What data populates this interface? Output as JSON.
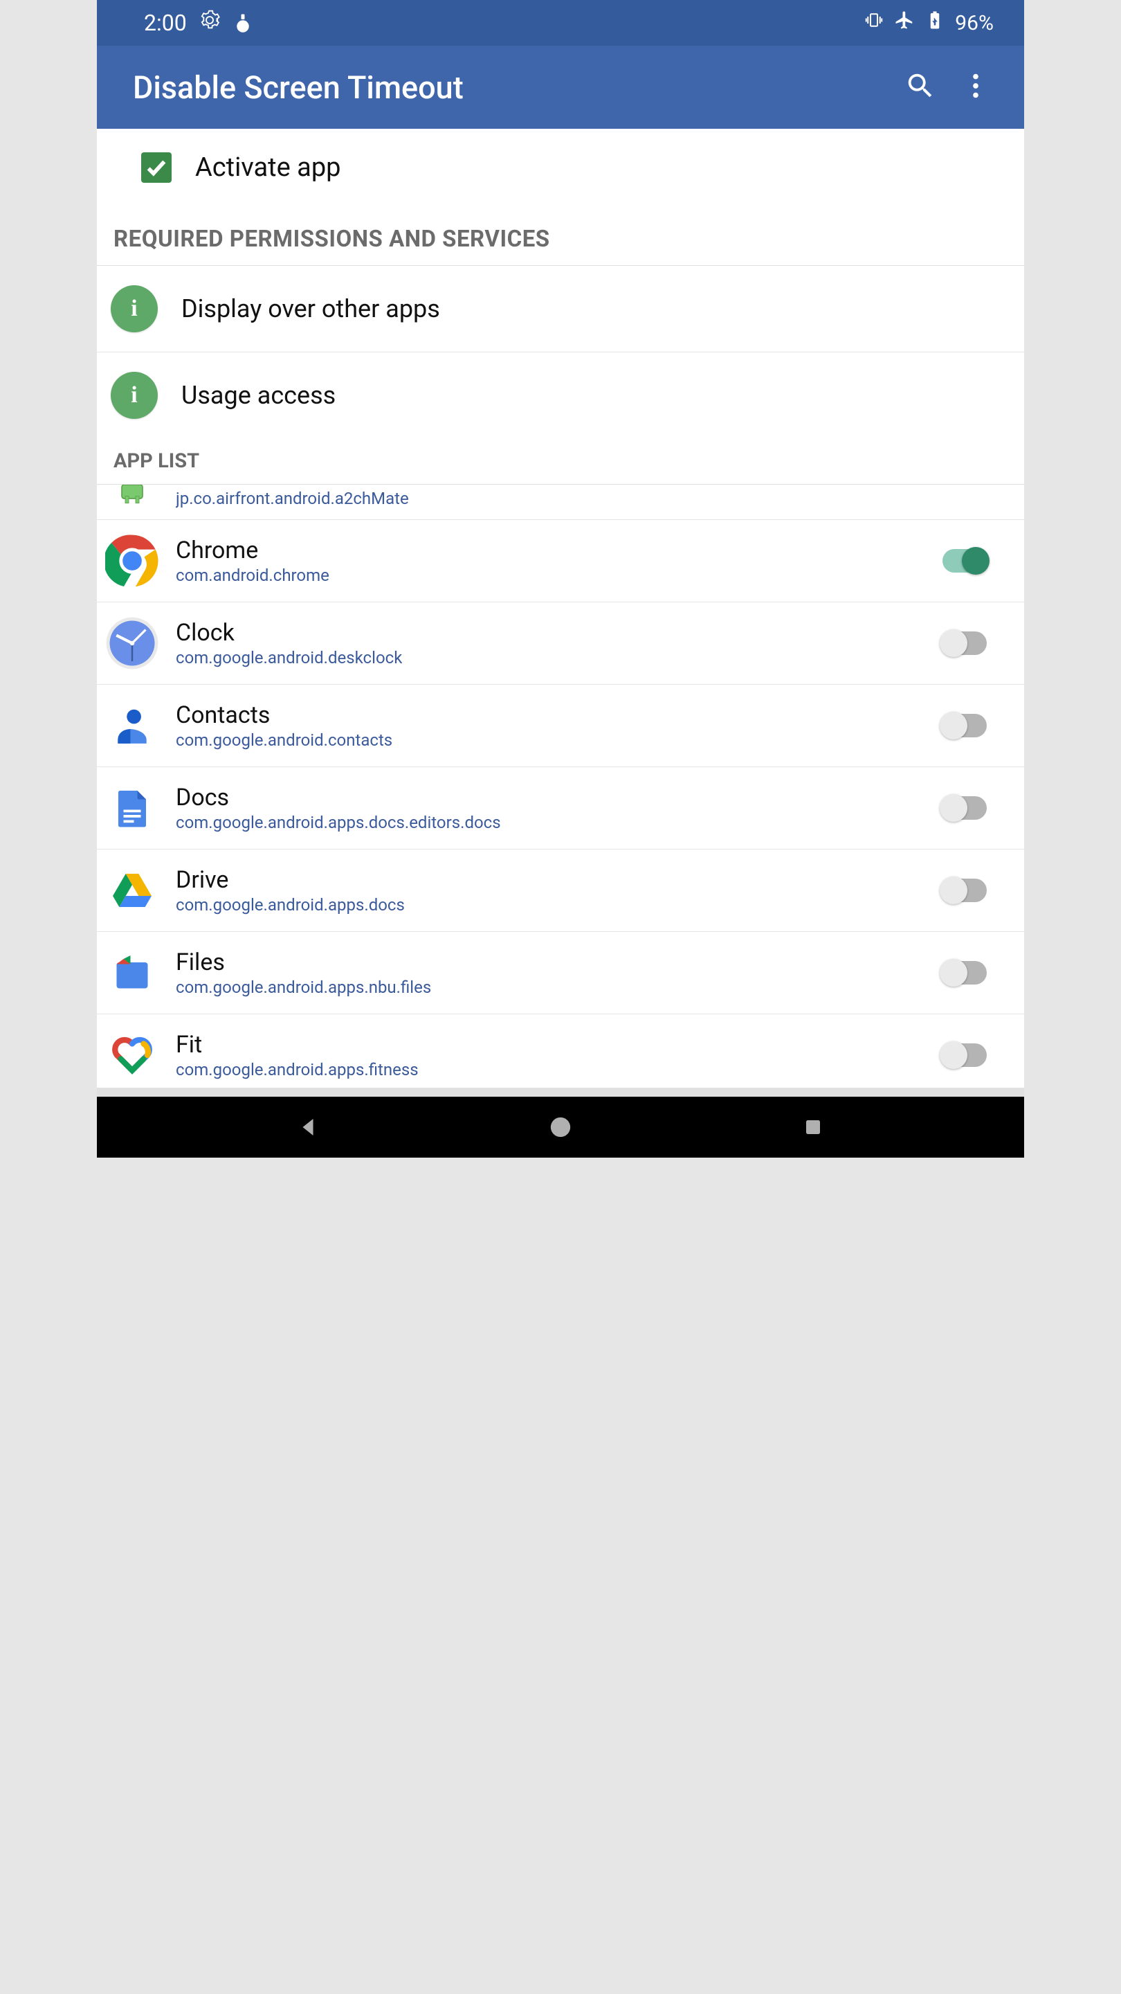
{
  "status": {
    "time": "2:00",
    "battery": "96%"
  },
  "appbar": {
    "title": "Disable Screen Timeout"
  },
  "activate": {
    "label": "Activate app",
    "checked": true
  },
  "sections": {
    "permissions_header": "REQUIRED PERMISSIONS AND SERVICES",
    "app_list_header": "APP LIST"
  },
  "permissions": [
    {
      "label": "Display over other apps"
    },
    {
      "label": "Usage access"
    }
  ],
  "apps": {
    "partial": {
      "package": "jp.co.airfront.android.a2chMate"
    },
    "chrome": {
      "name": "Chrome",
      "package": "com.android.chrome",
      "enabled": true
    },
    "clock": {
      "name": "Clock",
      "package": "com.google.android.deskclock",
      "enabled": false
    },
    "contacts": {
      "name": "Contacts",
      "package": "com.google.android.contacts",
      "enabled": false
    },
    "docs": {
      "name": "Docs",
      "package": "com.google.android.apps.docs.editors.docs",
      "enabled": false
    },
    "drive": {
      "name": "Drive",
      "package": "com.google.android.apps.docs",
      "enabled": false
    },
    "files": {
      "name": "Files",
      "package": "com.google.android.apps.nbu.files",
      "enabled": false
    },
    "fit": {
      "name": "Fit",
      "package": "com.google.android.apps.fitness",
      "enabled": false
    }
  }
}
